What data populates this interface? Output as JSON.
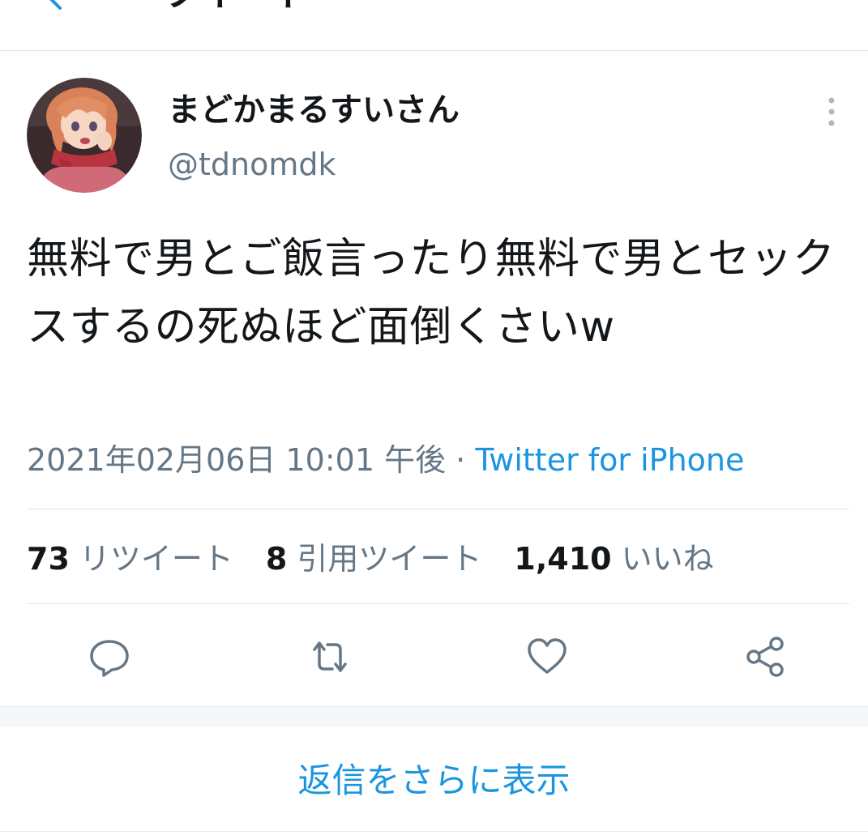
{
  "header": {
    "title": "ツイート"
  },
  "tweet": {
    "author": {
      "display_name": "まどかまるすいさん",
      "handle": "@tdnomdk"
    },
    "text": "無料で男とご飯言ったり無料で男とセックスするの死ぬほど面倒くさいw",
    "timestamp": "2021年02月06日 10:01 午後",
    "separator": " · ",
    "source": "Twitter for iPhone",
    "stats": {
      "retweets": {
        "count": "73",
        "label": "リツイート"
      },
      "quotes": {
        "count": "8",
        "label": "引用ツイート"
      },
      "likes": {
        "count": "1,410",
        "label": "いいね"
      }
    }
  },
  "footer": {
    "show_more_replies": "返信をさらに表示"
  },
  "colors": {
    "accent": "#1b95e0",
    "text_primary": "#14171a",
    "text_secondary": "#657786",
    "divider": "#dfe3e6"
  },
  "icons": [
    "back-arrow-icon",
    "more-vertical-icon",
    "reply-icon",
    "retweet-icon",
    "like-icon",
    "share-icon"
  ]
}
